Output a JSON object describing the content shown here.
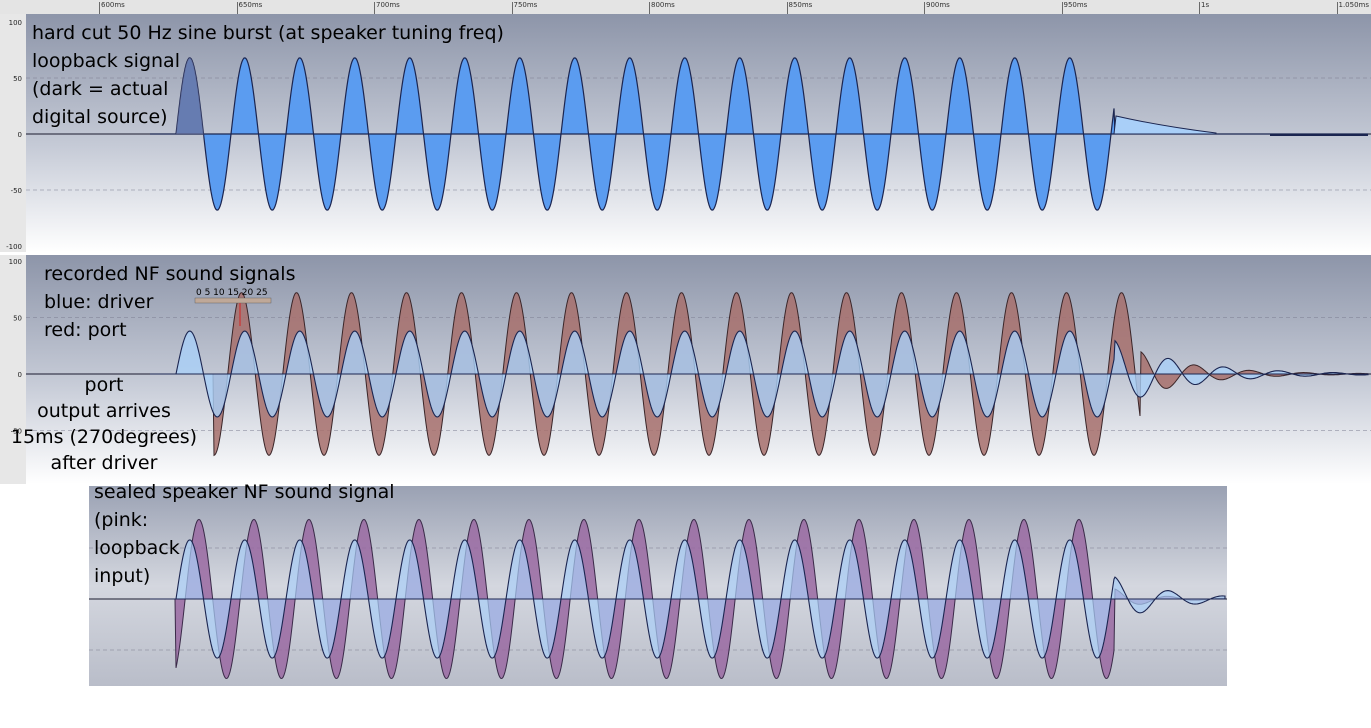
{
  "timeline": {
    "ticks": [
      {
        "label": "600ms",
        "x": 600
      },
      {
        "label": "650ms",
        "x": 650
      },
      {
        "label": "700ms",
        "x": 700
      },
      {
        "label": "750ms",
        "x": 750
      },
      {
        "label": "800ms",
        "x": 800
      },
      {
        "label": "850ms",
        "x": 850
      },
      {
        "label": "900ms",
        "x": 900
      },
      {
        "label": "950ms",
        "x": 950
      },
      {
        "label": "1s",
        "x": 1000
      },
      {
        "label": "1.050ms",
        "x": 1050
      }
    ]
  },
  "panels": [
    {
      "id": "loopback",
      "annotation": [
        "hard cut 50 Hz sine burst (at speaker tuning freq)",
        "loopback signal",
        "(dark = actual",
        "digital source)"
      ],
      "y_ticks": [
        "100",
        "50",
        "0",
        "-50",
        "-100"
      ]
    },
    {
      "id": "recorded",
      "annotation": [
        "recorded NF sound signals",
        "blue: driver",
        "red: port"
      ],
      "y_ticks": [
        "100",
        "50",
        "0",
        "-50"
      ],
      "mini_scale": "0 5 10 15 20 25",
      "side_note": [
        "port",
        "output arrives",
        "15ms (270degrees)",
        "after driver"
      ]
    },
    {
      "id": "sealed",
      "annotation": [
        "sealed speaker NF sound signal",
        "(pink:",
        "loopback",
        "input)"
      ]
    }
  ],
  "colors": {
    "blue_fill": "#5b9cf0",
    "light_blue_fill": "#a9cff8",
    "red_fill": "#a7706c",
    "pink_fill": "#9a6aa2",
    "violet_overlap": "#9a8ee6",
    "panel_top": "#8e96aa",
    "panel_bottom": "#ffffff"
  },
  "chart_data": [
    {
      "type": "line",
      "title": "hard cut 50 Hz sine burst (at speaker tuning freq)",
      "x_unit": "ms",
      "xlim": [
        580,
        1060
      ],
      "ylim": [
        -100,
        100
      ],
      "y_ticks": [
        100,
        50,
        0,
        -50,
        -100
      ],
      "series": [
        {
          "name": "loopback signal",
          "frequency_hz": 50,
          "amplitude": 68,
          "burst_start_ms": 636,
          "burst_end_ms": 952,
          "cycles": 16
        },
        {
          "name": "actual digital source",
          "frequency_hz": 50,
          "amplitude": 68,
          "burst_start_ms": 636,
          "burst_end_ms": 952
        }
      ],
      "grid": true
    },
    {
      "type": "line",
      "title": "recorded NF sound signals",
      "x_unit": "ms",
      "xlim": [
        580,
        1060
      ],
      "ylim": [
        -100,
        100
      ],
      "y_ticks": [
        100,
        50,
        0,
        -50
      ],
      "series": [
        {
          "name": "driver",
          "frequency_hz": 50,
          "amplitude": 38
        },
        {
          "name": "port",
          "frequency_hz": 50,
          "amplitude": 72,
          "delay_ms": 15,
          "delay_degrees": 270
        }
      ],
      "grid": true
    },
    {
      "type": "line",
      "title": "sealed speaker NF sound signal",
      "x_unit": "ms",
      "series": [
        {
          "name": "sealed speaker NF sound",
          "frequency_hz": 50,
          "amplitude": 58
        },
        {
          "name": "loopback input",
          "frequency_hz": 50,
          "amplitude": 58
        }
      ],
      "grid": true
    }
  ]
}
